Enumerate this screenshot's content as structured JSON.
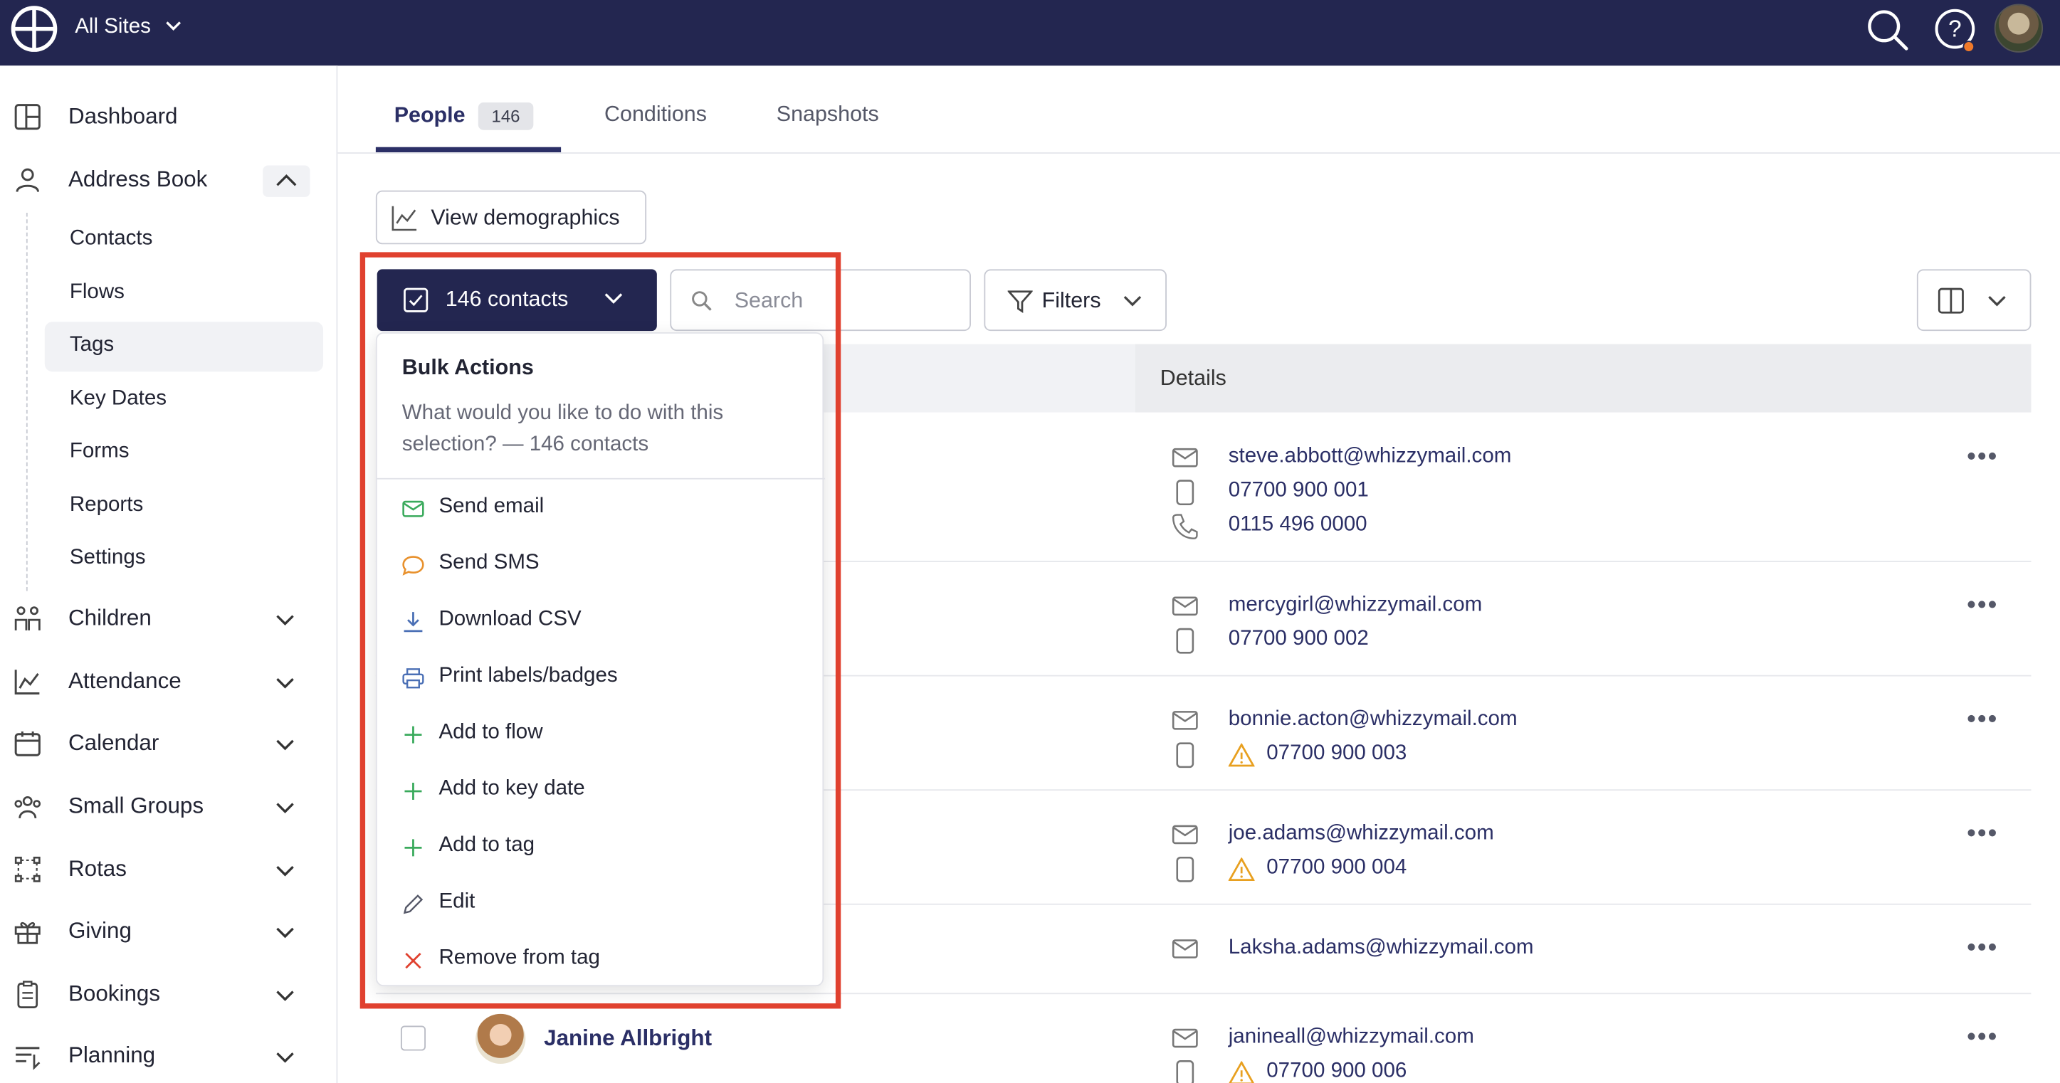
{
  "header": {
    "site_selector": "All Sites"
  },
  "sidebar": {
    "items": [
      {
        "label": "Dashboard",
        "icon": "dashboard-icon"
      },
      {
        "label": "Address Book",
        "icon": "person-icon",
        "expanded": true,
        "children": [
          "Contacts",
          "Flows",
          "Tags",
          "Key Dates",
          "Forms",
          "Reports",
          "Settings"
        ],
        "active_child": "Tags"
      },
      {
        "label": "Children",
        "icon": "children-icon"
      },
      {
        "label": "Attendance",
        "icon": "chart-icon"
      },
      {
        "label": "Calendar",
        "icon": "calendar-icon"
      },
      {
        "label": "Small Groups",
        "icon": "groups-icon"
      },
      {
        "label": "Rotas",
        "icon": "rotas-icon"
      },
      {
        "label": "Giving",
        "icon": "gift-icon"
      },
      {
        "label": "Bookings",
        "icon": "clipboard-icon"
      },
      {
        "label": "Planning",
        "icon": "planning-icon"
      }
    ]
  },
  "tabs": [
    {
      "label": "People",
      "count": "146",
      "active": true
    },
    {
      "label": "Conditions"
    },
    {
      "label": "Snapshots"
    }
  ],
  "toolbar": {
    "demographics_label": "View demographics",
    "selection_label": "146 contacts",
    "search_placeholder": "Search",
    "filters_label": "Filters"
  },
  "table": {
    "details_header": "Details",
    "rows": [
      {
        "email": "steve.abbott@whizzymail.com",
        "mobile": "07700 900 001",
        "phone": "0115 496 0000"
      },
      {
        "email": "mercygirl@whizzymail.com",
        "mobile": "07700 900 002"
      },
      {
        "email": "bonnie.acton@whizzymail.com",
        "mobile": "07700 900 003",
        "mobile_warning": true
      },
      {
        "email": "joe.adams@whizzymail.com",
        "mobile": "07700 900 004",
        "mobile_warning": true
      },
      {
        "email": "Laksha.adams@whizzymail.com"
      },
      {
        "name": "Janine Allbright",
        "email": "janineall@whizzymail.com",
        "mobile": "07700 900 006",
        "mobile_warning": true
      }
    ]
  },
  "bulk_actions": {
    "title": "Bulk Actions",
    "description": "What would you like to do with this selection? — 146 contacts",
    "items": [
      {
        "label": "Send email",
        "icon": "mail-icon",
        "color": "#3aaa5c"
      },
      {
        "label": "Send SMS",
        "icon": "chat-icon",
        "color": "#e8912d"
      },
      {
        "label": "Download CSV",
        "icon": "download-icon",
        "color": "#4a6fb5"
      },
      {
        "label": "Print labels/badges",
        "icon": "printer-icon",
        "color": "#4a6fb5"
      },
      {
        "label": "Add to flow",
        "icon": "plus-icon",
        "color": "#3aaa5c"
      },
      {
        "label": "Add to key date",
        "icon": "plus-icon",
        "color": "#3aaa5c"
      },
      {
        "label": "Add to tag",
        "icon": "plus-icon",
        "color": "#3aaa5c"
      },
      {
        "label": "Edit",
        "icon": "pencil-icon",
        "color": "#555868"
      },
      {
        "label": "Remove from tag",
        "icon": "close-icon",
        "color": "#e0412f"
      }
    ]
  },
  "colors": {
    "navy": "#232650",
    "highlight": "#e0412f",
    "link": "#2b2f66",
    "warning": "#e8a020"
  }
}
